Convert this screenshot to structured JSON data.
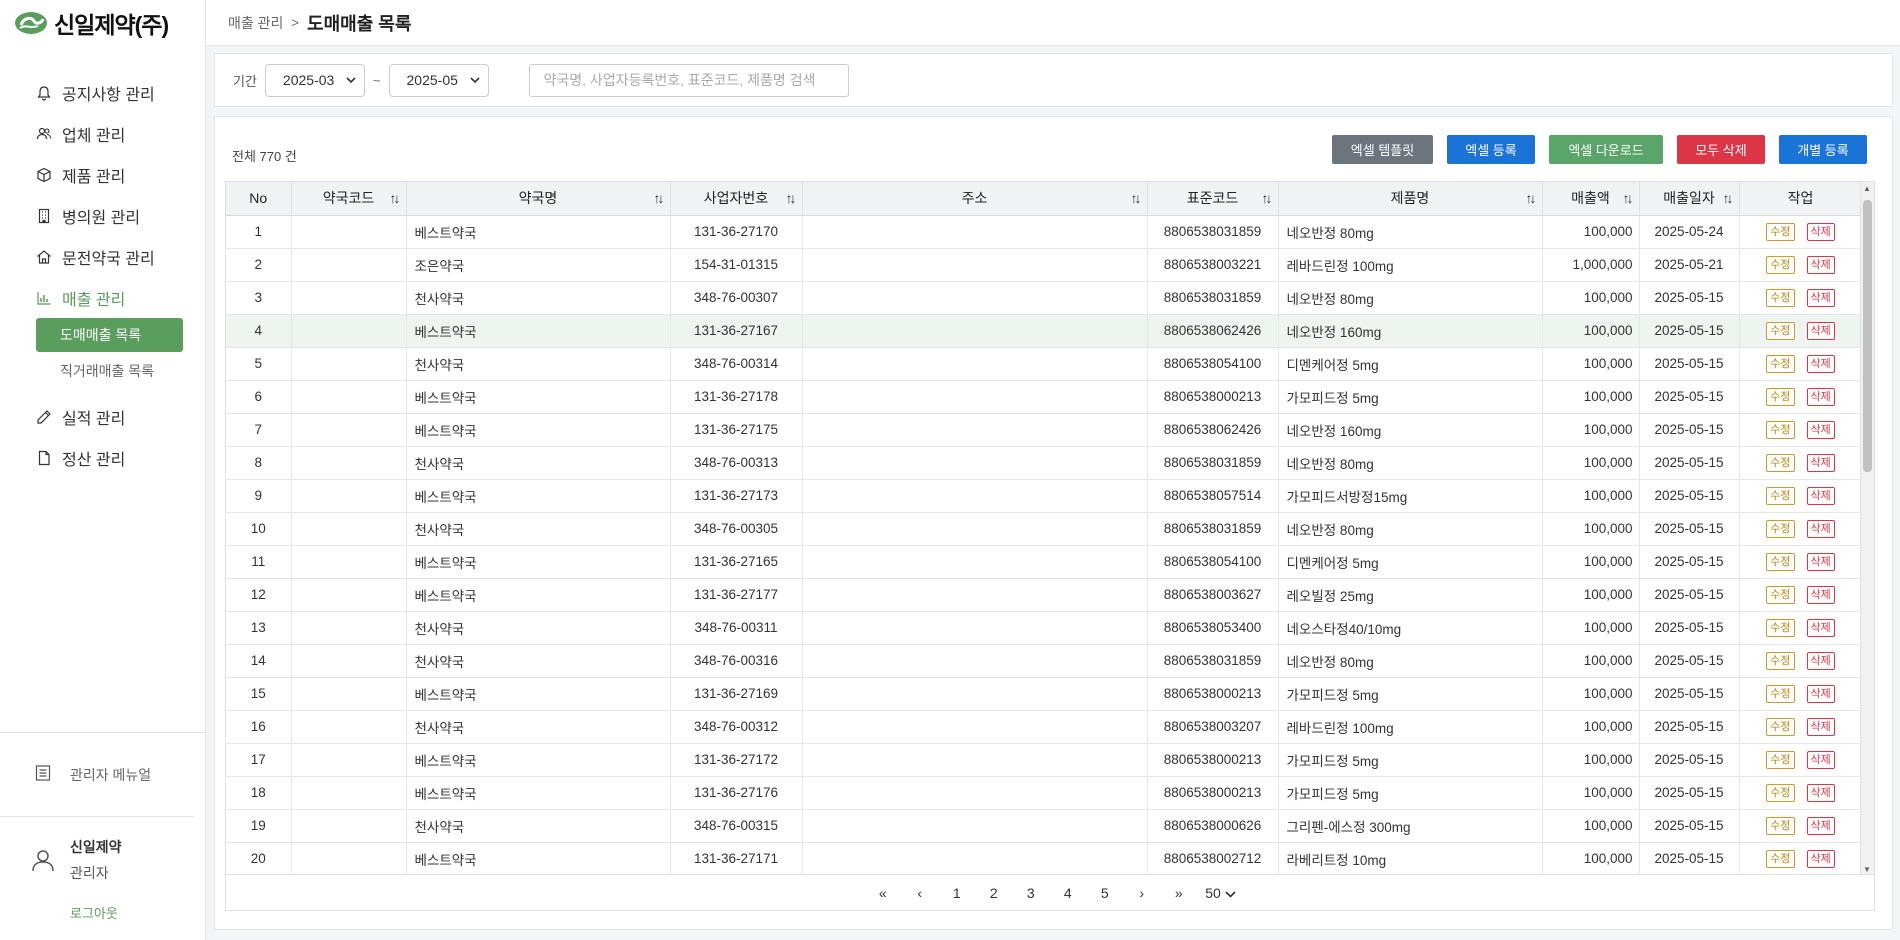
{
  "brand": {
    "name": "신일제약(주)",
    "color": "#5a9e5e"
  },
  "sidebar": {
    "items": [
      {
        "label": "공지사항 관리",
        "icon": "bell-icon"
      },
      {
        "label": "업체 관리",
        "icon": "users-icon"
      },
      {
        "label": "제품 관리",
        "icon": "box-icon"
      },
      {
        "label": "병의원 관리",
        "icon": "building-icon"
      },
      {
        "label": "문전약국 관리",
        "icon": "home-icon"
      },
      {
        "label": "매출 관리",
        "icon": "bar-chart-icon"
      },
      {
        "label": "실적 관리",
        "icon": "pencil-icon"
      },
      {
        "label": "정산 관리",
        "icon": "document-icon"
      }
    ],
    "sub_items": [
      {
        "label": "도매매출 목록"
      },
      {
        "label": "직거래매출 목록"
      }
    ],
    "manual_label": "관리자 메뉴얼",
    "user": {
      "name": "신일제약",
      "role": "관리자"
    },
    "logout_label": "로그아웃"
  },
  "header": {
    "breadcrumb": "매출 관리",
    "separator": ">",
    "title": "도매매출 목록"
  },
  "filter": {
    "period_label": "기간",
    "from": "2025-03",
    "to": "2025-05",
    "tilde": "~",
    "search_placeholder": "약국명, 사업자등록번호, 표준코드, 제품명 검색"
  },
  "toolbar": {
    "total": "전체 770 건",
    "excel_template": "엑셀 템플릿",
    "excel_register": "엑셀 등록",
    "excel_download": "엑셀 다운로드",
    "delete_all": "모두 삭제",
    "individual_register": "개별 등록"
  },
  "table": {
    "columns": [
      "No",
      "약국코드",
      "약국명",
      "사업자번호",
      "주소",
      "표준코드",
      "제품명",
      "매출액",
      "매출일자",
      "작업"
    ],
    "edit_label": "수정",
    "delete_label": "삭제",
    "rows": [
      {
        "no": "1",
        "code": "",
        "name": "베스트약국",
        "biz": "131-36-27170",
        "addr": "",
        "std": "8806538031859",
        "product": "네오반정 80mg",
        "amount": "100,000",
        "date": "2025-05-24"
      },
      {
        "no": "2",
        "code": "",
        "name": "조은약국",
        "biz": "154-31-01315",
        "addr": "",
        "std": "8806538003221",
        "product": "레바드린정 100mg",
        "amount": "1,000,000",
        "date": "2025-05-21"
      },
      {
        "no": "3",
        "code": "",
        "name": "천사약국",
        "biz": "348-76-00307",
        "addr": "",
        "std": "8806538031859",
        "product": "네오반정 80mg",
        "amount": "100,000",
        "date": "2025-05-15"
      },
      {
        "no": "4",
        "code": "",
        "name": "베스트약국",
        "biz": "131-36-27167",
        "addr": "",
        "std": "8806538062426",
        "product": "네오반정 160mg",
        "amount": "100,000",
        "date": "2025-05-15"
      },
      {
        "no": "5",
        "code": "",
        "name": "천사약국",
        "biz": "348-76-00314",
        "addr": "",
        "std": "8806538054100",
        "product": "디멘케어정 5mg",
        "amount": "100,000",
        "date": "2025-05-15"
      },
      {
        "no": "6",
        "code": "",
        "name": "베스트약국",
        "biz": "131-36-27178",
        "addr": "",
        "std": "8806538000213",
        "product": "가모피드정 5mg",
        "amount": "100,000",
        "date": "2025-05-15"
      },
      {
        "no": "7",
        "code": "",
        "name": "베스트약국",
        "biz": "131-36-27175",
        "addr": "",
        "std": "8806538062426",
        "product": "네오반정 160mg",
        "amount": "100,000",
        "date": "2025-05-15"
      },
      {
        "no": "8",
        "code": "",
        "name": "천사약국",
        "biz": "348-76-00313",
        "addr": "",
        "std": "8806538031859",
        "product": "네오반정 80mg",
        "amount": "100,000",
        "date": "2025-05-15"
      },
      {
        "no": "9",
        "code": "",
        "name": "베스트약국",
        "biz": "131-36-27173",
        "addr": "",
        "std": "8806538057514",
        "product": "가모피드서방정15mg",
        "amount": "100,000",
        "date": "2025-05-15"
      },
      {
        "no": "10",
        "code": "",
        "name": "천사약국",
        "biz": "348-76-00305",
        "addr": "",
        "std": "8806538031859",
        "product": "네오반정 80mg",
        "amount": "100,000",
        "date": "2025-05-15"
      },
      {
        "no": "11",
        "code": "",
        "name": "베스트약국",
        "biz": "131-36-27165",
        "addr": "",
        "std": "8806538054100",
        "product": "디멘케어정 5mg",
        "amount": "100,000",
        "date": "2025-05-15"
      },
      {
        "no": "12",
        "code": "",
        "name": "베스트약국",
        "biz": "131-36-27177",
        "addr": "",
        "std": "8806538003627",
        "product": "레오빌정 25mg",
        "amount": "100,000",
        "date": "2025-05-15"
      },
      {
        "no": "13",
        "code": "",
        "name": "천사약국",
        "biz": "348-76-00311",
        "addr": "",
        "std": "8806538053400",
        "product": "네오스타정40/10mg",
        "amount": "100,000",
        "date": "2025-05-15"
      },
      {
        "no": "14",
        "code": "",
        "name": "천사약국",
        "biz": "348-76-00316",
        "addr": "",
        "std": "8806538031859",
        "product": "네오반정 80mg",
        "amount": "100,000",
        "date": "2025-05-15"
      },
      {
        "no": "15",
        "code": "",
        "name": "베스트약국",
        "biz": "131-36-27169",
        "addr": "",
        "std": "8806538000213",
        "product": "가모피드정 5mg",
        "amount": "100,000",
        "date": "2025-05-15"
      },
      {
        "no": "16",
        "code": "",
        "name": "천사약국",
        "biz": "348-76-00312",
        "addr": "",
        "std": "8806538003207",
        "product": "레바드린정 100mg",
        "amount": "100,000",
        "date": "2025-05-15"
      },
      {
        "no": "17",
        "code": "",
        "name": "베스트약국",
        "biz": "131-36-27172",
        "addr": "",
        "std": "8806538000213",
        "product": "가모피드정 5mg",
        "amount": "100,000",
        "date": "2025-05-15"
      },
      {
        "no": "18",
        "code": "",
        "name": "베스트약국",
        "biz": "131-36-27176",
        "addr": "",
        "std": "8806538000213",
        "product": "가모피드정 5mg",
        "amount": "100,000",
        "date": "2025-05-15"
      },
      {
        "no": "19",
        "code": "",
        "name": "천사약국",
        "biz": "348-76-00315",
        "addr": "",
        "std": "8806538000626",
        "product": "그리펜-에스정 300mg",
        "amount": "100,000",
        "date": "2025-05-15"
      },
      {
        "no": "20",
        "code": "",
        "name": "베스트약국",
        "biz": "131-36-27171",
        "addr": "",
        "std": "8806538002712",
        "product": "라베리트정 10mg",
        "amount": "100,000",
        "date": "2025-05-15"
      }
    ]
  },
  "pagination": {
    "first": "«",
    "prev": "‹",
    "pages": [
      "1",
      "2",
      "3",
      "4",
      "5"
    ],
    "next": "›",
    "last": "»",
    "per_page": "50"
  }
}
